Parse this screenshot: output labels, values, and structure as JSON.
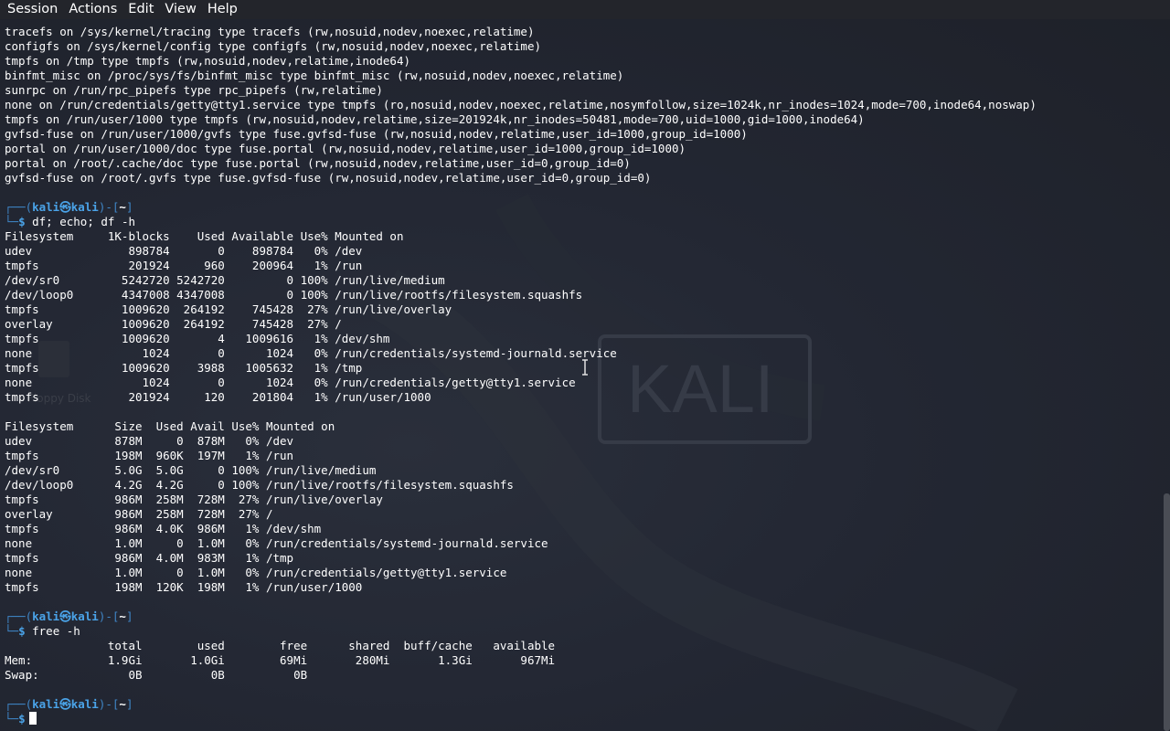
{
  "menu": [
    "Session",
    "Actions",
    "Edit",
    "View",
    "Help"
  ],
  "background": {
    "logo_text": "KALI",
    "desktop_label": "Floppy Disk"
  },
  "prompt": {
    "user": "kali",
    "host": "kali",
    "dir": "~",
    "symbol": "$"
  },
  "mount_lines": [
    "tracefs on /sys/kernel/tracing type tracefs (rw,nosuid,nodev,noexec,relatime)",
    "configfs on /sys/kernel/config type configfs (rw,nosuid,nodev,noexec,relatime)",
    "tmpfs on /tmp type tmpfs (rw,nosuid,nodev,relatime,inode64)",
    "binfmt_misc on /proc/sys/fs/binfmt_misc type binfmt_misc (rw,nosuid,nodev,noexec,relatime)",
    "sunrpc on /run/rpc_pipefs type rpc_pipefs (rw,relatime)",
    "none on /run/credentials/getty@tty1.service type tmpfs (ro,nosuid,nodev,noexec,relatime,nosymfollow,size=1024k,nr_inodes=1024,mode=700,inode64,noswap)",
    "tmpfs on /run/user/1000 type tmpfs (rw,nosuid,nodev,relatime,size=201924k,nr_inodes=50481,mode=700,uid=1000,gid=1000,inode64)",
    "gvfsd-fuse on /run/user/1000/gvfs type fuse.gvfsd-fuse (rw,nosuid,nodev,relatime,user_id=1000,group_id=1000)",
    "portal on /run/user/1000/doc type fuse.portal (rw,nosuid,nodev,relatime,user_id=1000,group_id=1000)",
    "portal on /root/.cache/doc type fuse.portal (rw,nosuid,nodev,relatime,user_id=0,group_id=0)",
    "gvfsd-fuse on /root/.gvfs type fuse.gvfsd-fuse (rw,nosuid,nodev,relatime,user_id=0,group_id=0)"
  ],
  "cmd1": "df; echo; df -h",
  "df_lines": [
    "Filesystem     1K-blocks    Used Available Use% Mounted on",
    "udev              898784       0    898784   0% /dev",
    "tmpfs             201924     960    200964   1% /run",
    "/dev/sr0         5242720 5242720         0 100% /run/live/medium",
    "/dev/loop0       4347008 4347008         0 100% /run/live/rootfs/filesystem.squashfs",
    "tmpfs            1009620  264192    745428  27% /run/live/overlay",
    "overlay          1009620  264192    745428  27% /",
    "tmpfs            1009620       4   1009616   1% /dev/shm",
    "none                1024       0      1024   0% /run/credentials/systemd-journald.service",
    "tmpfs            1009620    3988   1005632   1% /tmp",
    "none                1024       0      1024   0% /run/credentials/getty@tty1.service",
    "tmpfs             201924     120    201804   1% /run/user/1000"
  ],
  "dfh_lines": [
    "Filesystem      Size  Used Avail Use% Mounted on",
    "udev            878M     0  878M   0% /dev",
    "tmpfs           198M  960K  197M   1% /run",
    "/dev/sr0        5.0G  5.0G     0 100% /run/live/medium",
    "/dev/loop0      4.2G  4.2G     0 100% /run/live/rootfs/filesystem.squashfs",
    "tmpfs           986M  258M  728M  27% /run/live/overlay",
    "overlay         986M  258M  728M  27% /",
    "tmpfs           986M  4.0K  986M   1% /dev/shm",
    "none            1.0M     0  1.0M   0% /run/credentials/systemd-journald.service",
    "tmpfs           986M  4.0M  983M   1% /tmp",
    "none            1.0M     0  1.0M   0% /run/credentials/getty@tty1.service",
    "tmpfs           198M  120K  198M   1% /run/user/1000"
  ],
  "cmd2": "free -h",
  "free_lines": [
    "               total        used        free      shared  buff/cache   available",
    "Mem:           1.9Gi       1.0Gi        69Mi       280Mi       1.3Gi       967Mi",
    "Swap:             0B          0B          0B"
  ],
  "colors": {
    "terminal_bg": "#1f232d",
    "menubar_bg": "#23252b",
    "prompt_blue": "#3f86c7",
    "prompt_user": "#4aa3e8"
  }
}
